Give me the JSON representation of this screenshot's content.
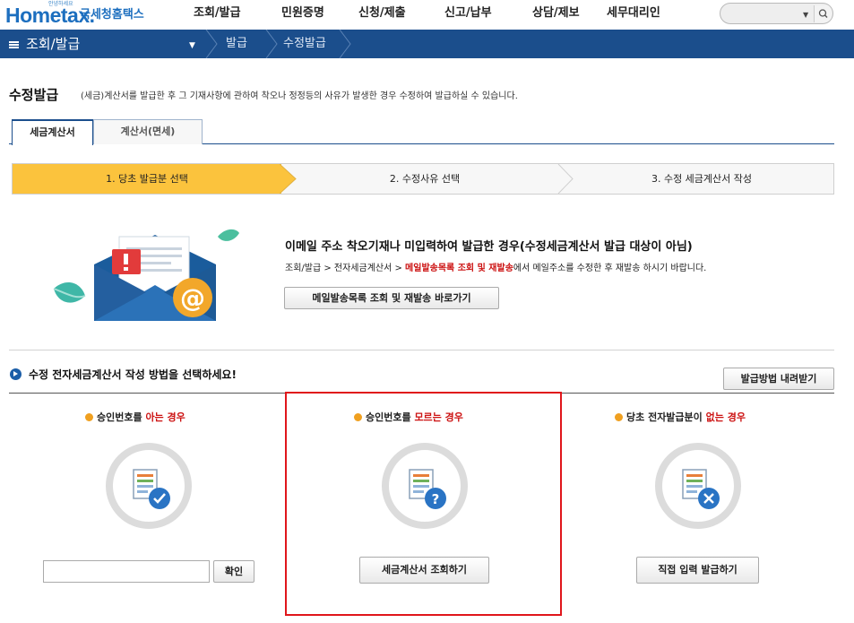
{
  "header": {
    "logo_brand": "Hometax.",
    "logo_sub": "국세청홈택스",
    "logo_tiny": "안녕하세요",
    "nav": [
      "조회/발급",
      "민원증명",
      "신청/제출",
      "신고/납부",
      "상담/제보",
      "세무대리인"
    ],
    "search_value": ""
  },
  "blue_nav": {
    "menu_label": "조회/발급",
    "breadcrumb": [
      "발급",
      "수정발급"
    ]
  },
  "page": {
    "title": "수정발급",
    "description": "(세금)계산서를 발급한 후 그 기재사항에 관하여 착오나 정정등의 사유가 발생한 경우 수정하여 발급하실 수 있습니다."
  },
  "tabs": [
    {
      "label": "세금계산서",
      "active": true
    },
    {
      "label": "계산서(면세)",
      "active": false
    }
  ],
  "steps": [
    {
      "label": "1. 당초 발급분 선택",
      "active": true
    },
    {
      "label": "2. 수정사유 선택",
      "active": false
    },
    {
      "label": "3. 수정 세금계산서 작성",
      "active": false
    }
  ],
  "notice": {
    "title": "이메일 주소 착오기재나 미입력하여 발급한 경우(수정세금계산서 발급 대상이 아님)",
    "body_prefix": "조회/발급 > 전자세금계산서 > ",
    "body_highlight": "메일발송목록 조회 및 재발송",
    "body_suffix": "에서 메일주소를 수정한 후 재발송 하시기 바랍니다.",
    "button": "메일발송목록 조회 및 재발송 바로가기"
  },
  "method": {
    "title": "수정 전자세금계산서 작성 방법을 선택하세요!",
    "download_button": "발급방법 내려받기",
    "columns": [
      {
        "title_prefix": "승인번호를 ",
        "title_highlight": "아는 경우",
        "title_suffix": "",
        "icon": "document-check-icon",
        "input_placeholder": "",
        "button": "확인"
      },
      {
        "title_prefix": "승인번호를 ",
        "title_highlight": "모르는 경우",
        "title_suffix": "",
        "icon": "document-question-icon",
        "button": "세금계산서 조회하기"
      },
      {
        "title_prefix": "당초 전자발급분이 ",
        "title_highlight": "없는 경우",
        "title_suffix": "",
        "icon": "document-x-icon",
        "button": "직접 입력 발급하기"
      }
    ]
  },
  "colors": {
    "primary_blue": "#1b4e8c",
    "step_active": "#fbc33d",
    "highlight_red": "#cc1111",
    "selection_border": "#e0161b"
  }
}
